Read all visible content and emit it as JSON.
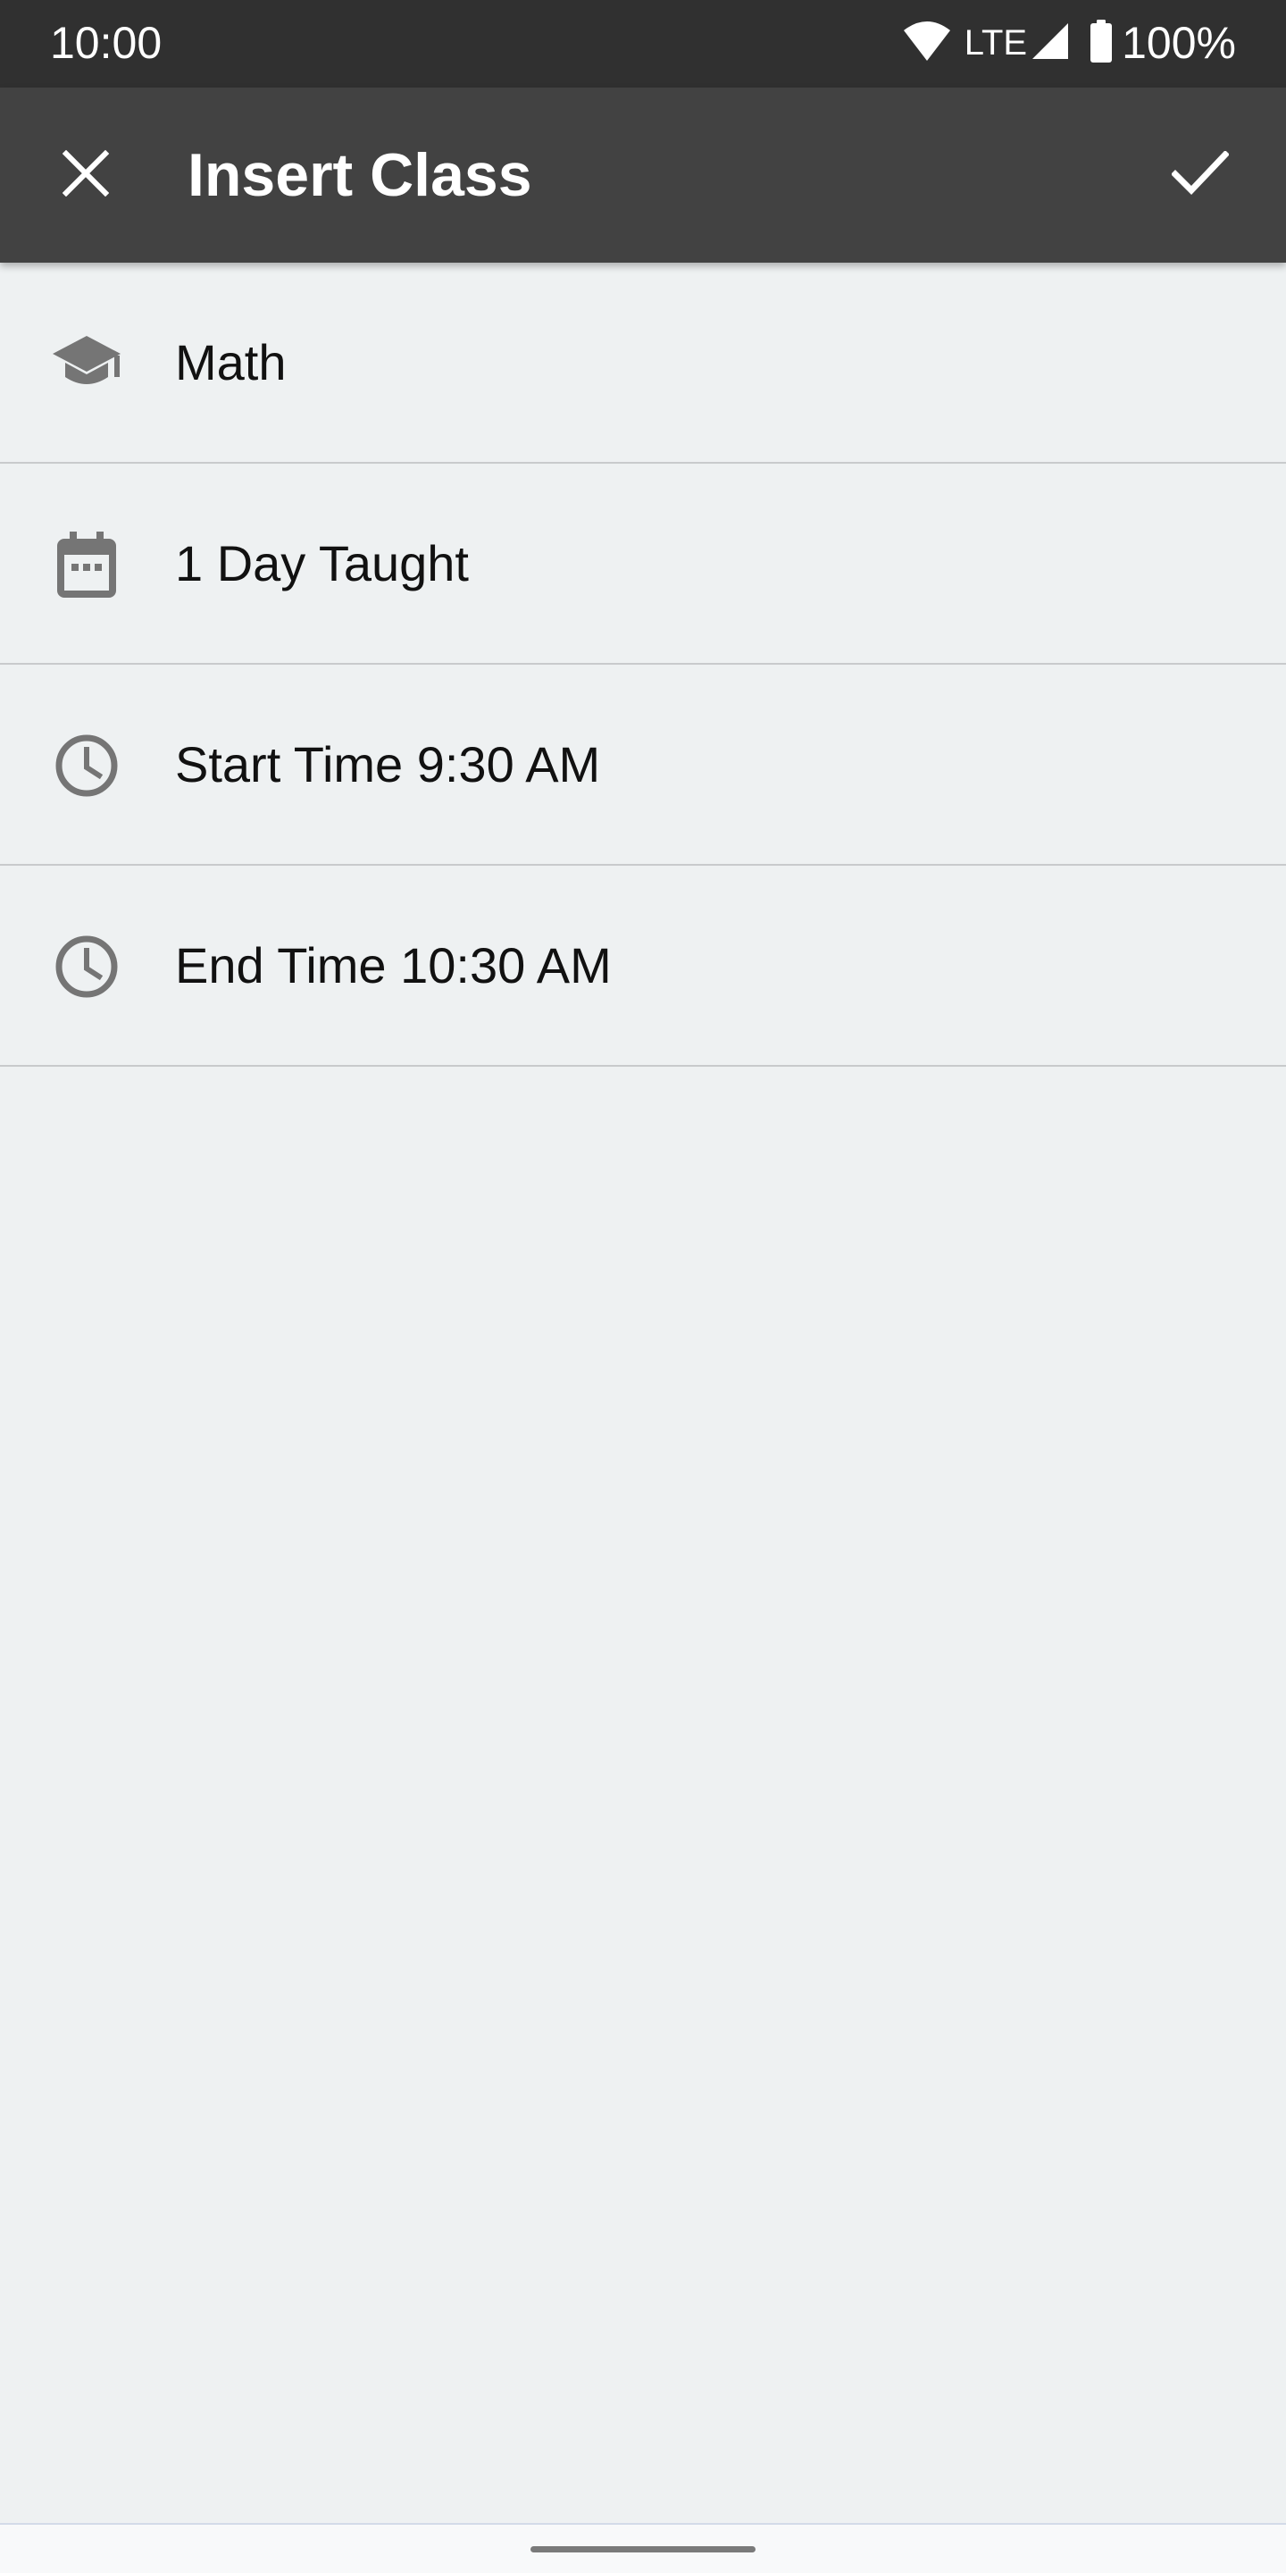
{
  "status_bar": {
    "time": "10:00",
    "network": "LTE",
    "battery": "100%",
    "icons": [
      "wifi-icon",
      "signal-icon",
      "battery-icon"
    ]
  },
  "app_bar": {
    "title": "Insert Class",
    "close_icon": "close-icon",
    "confirm_icon": "check-icon",
    "background": "#424242"
  },
  "list": {
    "items": [
      {
        "icon": "school-icon",
        "label": "Math"
      },
      {
        "icon": "calendar-icon",
        "label": "1 Day Taught"
      },
      {
        "icon": "clock-icon",
        "label": "Start Time 9:30 AM"
      },
      {
        "icon": "clock-icon",
        "label": "End Time 10:30 AM"
      }
    ]
  },
  "colors": {
    "status_bar": "#303030",
    "app_bar": "#424242",
    "page_background": "#eef1f2",
    "icon": "#757575",
    "text": "#111111",
    "divider": "#c8cacc"
  }
}
